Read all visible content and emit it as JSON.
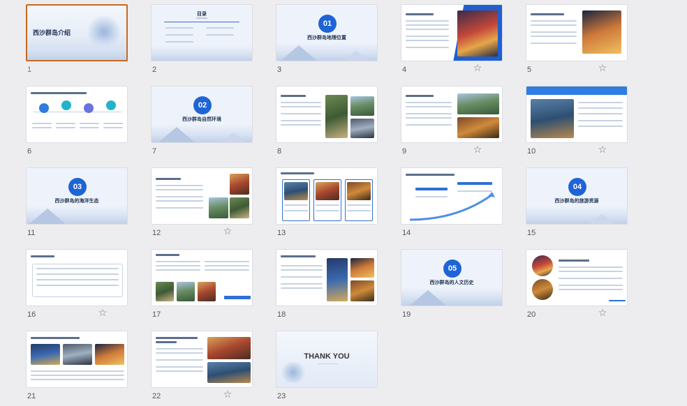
{
  "slides": [
    {
      "num": "1",
      "title": "西沙群岛介绍",
      "selected": true,
      "star": false
    },
    {
      "num": "2",
      "title": "目录",
      "subtitle": "CONTENTS",
      "star": false
    },
    {
      "num": "3",
      "badge": "01",
      "title": "西沙群岛地理位置",
      "star": false
    },
    {
      "num": "4",
      "star": true
    },
    {
      "num": "5",
      "star": true
    },
    {
      "num": "6",
      "star": false
    },
    {
      "num": "7",
      "badge": "02",
      "title": "西沙群岛自然环境",
      "star": false
    },
    {
      "num": "8",
      "star": false
    },
    {
      "num": "9",
      "star": true
    },
    {
      "num": "10",
      "star": true
    },
    {
      "num": "11",
      "badge": "03",
      "title": "西沙群岛的海洋生态",
      "star": false
    },
    {
      "num": "12",
      "star": true
    },
    {
      "num": "13",
      "star": false
    },
    {
      "num": "14",
      "star": false
    },
    {
      "num": "15",
      "badge": "04",
      "title": "西沙群岛的旅游资源",
      "star": false
    },
    {
      "num": "16",
      "star": true
    },
    {
      "num": "17",
      "star": false
    },
    {
      "num": "18",
      "star": false
    },
    {
      "num": "19",
      "badge": "05",
      "title": "西沙群岛的人文历史",
      "star": false
    },
    {
      "num": "20",
      "star": true
    },
    {
      "num": "21",
      "star": false
    },
    {
      "num": "22",
      "star": true
    },
    {
      "num": "23",
      "title": "THANK YOU",
      "star": false
    }
  ],
  "icons": {
    "star": "star-outline-icon"
  },
  "colors": {
    "accent": "#1e64d6",
    "selected_border": "#c8681f",
    "background": "#ededf0"
  }
}
